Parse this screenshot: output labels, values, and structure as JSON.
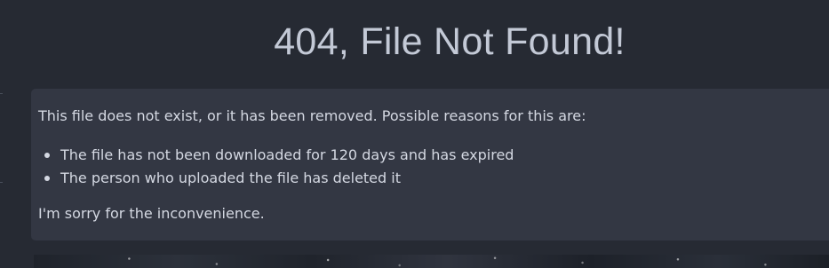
{
  "page": {
    "title": "404, File Not Found!"
  },
  "message": {
    "intro": "This file does not exist, or it has been removed. Possible reasons for this are:",
    "reasons": [
      "The file has not been downloaded for 120 days and has expired",
      "The person who uploaded the file has deleted it"
    ],
    "apology": "I'm sorry for the inconvenience."
  },
  "colors": {
    "page_background": "#262a33",
    "panel_background": "#333743",
    "title_text": "#c3c9d6",
    "body_text": "#d4d8e2"
  }
}
